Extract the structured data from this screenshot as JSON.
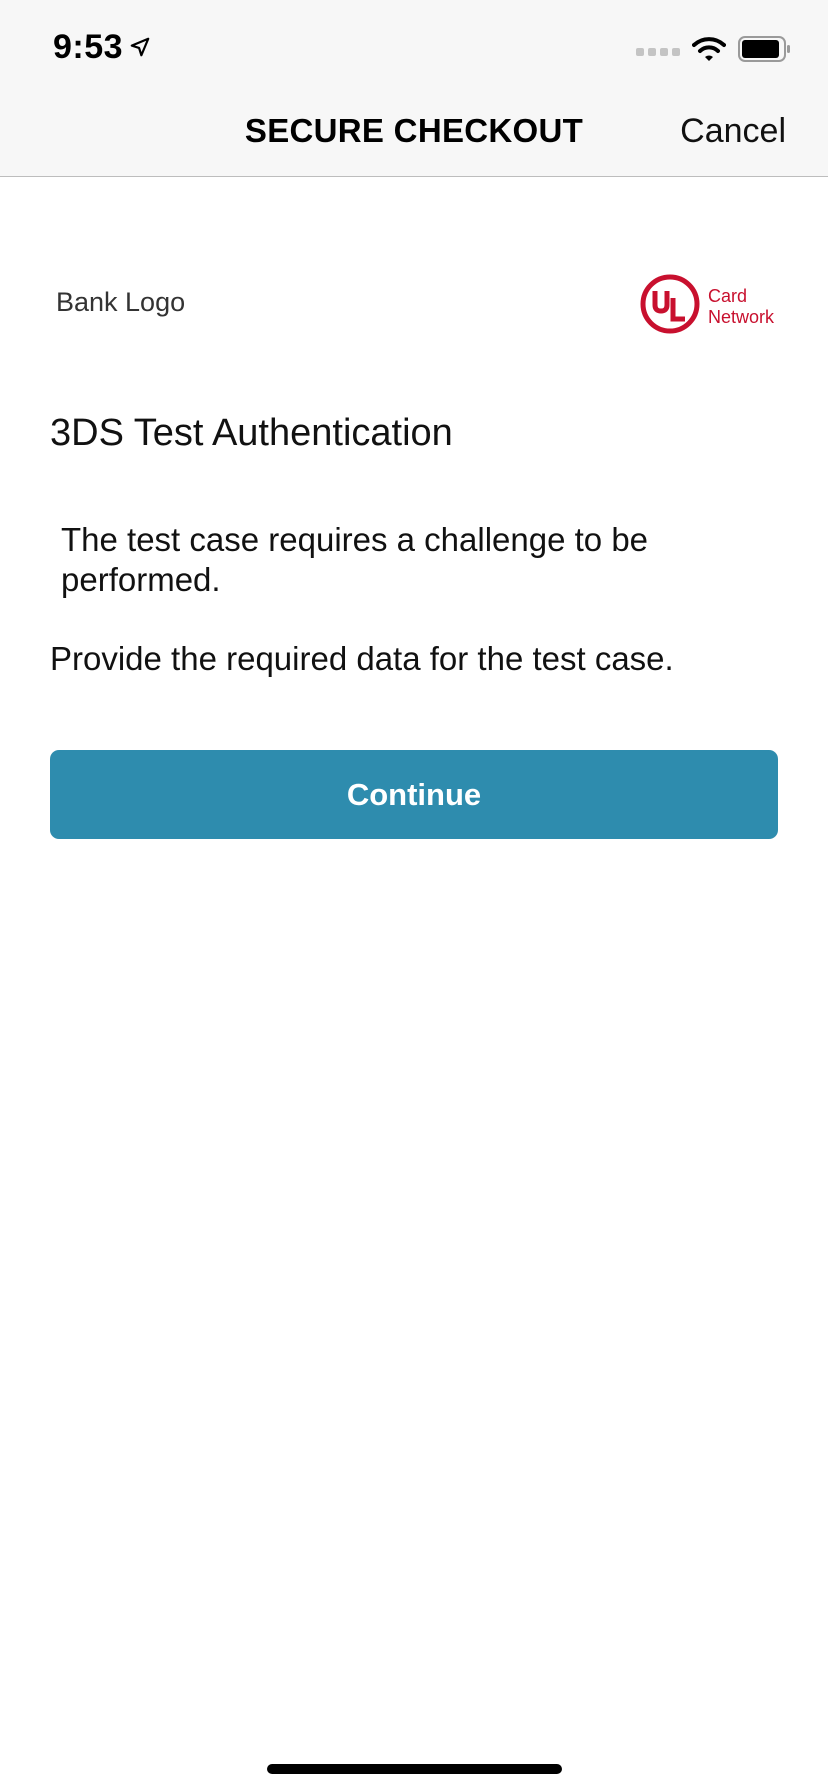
{
  "status_bar": {
    "time": "9:53",
    "location_icon": "location-arrow-icon",
    "wifi_icon": "wifi-icon",
    "battery_icon": "battery-icon"
  },
  "nav": {
    "title": "SECURE CHECKOUT",
    "cancel_label": "Cancel"
  },
  "header": {
    "bank_logo_text": "Bank Logo",
    "network_logo": {
      "mark": "UL",
      "line1": "Card",
      "line2": "Network",
      "color": "#c8102e"
    }
  },
  "challenge": {
    "title": "3DS Test Authentication",
    "info_text": "The test case requires a challenge to be performed.",
    "prompt": "Provide the required data for the test case.",
    "continue_label": "Continue"
  },
  "colors": {
    "accent": "#2e8cae",
    "nav_background": "#f7f7f7",
    "brand_red": "#c8102e"
  }
}
